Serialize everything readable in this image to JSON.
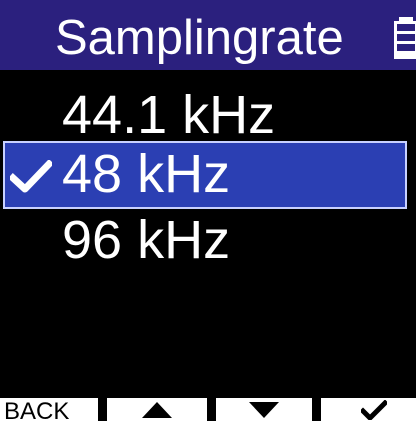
{
  "header": {
    "title": "Samplingrate",
    "icon": "battery-icon",
    "background": "#2b207e"
  },
  "options": [
    {
      "label": "44.1 kHz",
      "selected": false
    },
    {
      "label": "48 kHz",
      "selected": true
    },
    {
      "label": "96 kHz",
      "selected": false
    }
  ],
  "selection_color": "#2b3fb3",
  "selected_icon": "checkmark-icon",
  "softkeys": {
    "back_label": "BACK",
    "up_icon": "up-arrow-icon",
    "down_icon": "down-arrow-icon",
    "confirm_icon": "checkmark-icon"
  }
}
